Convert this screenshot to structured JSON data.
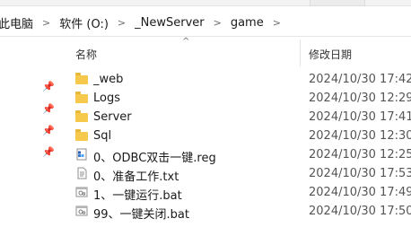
{
  "breadcrumb": {
    "items": [
      {
        "label": "此电脑"
      },
      {
        "label": "软件 (O:)"
      },
      {
        "label": "_NewServer"
      },
      {
        "label": "game"
      }
    ]
  },
  "header": {
    "name_label": "名称",
    "date_label": "修改日期"
  },
  "files": [
    {
      "name": "_web",
      "date": "2024/10/30 17:42",
      "icon": "folder-icon"
    },
    {
      "name": "Logs",
      "date": "2024/10/30 12:29",
      "icon": "folder-icon"
    },
    {
      "name": "Server",
      "date": "2024/10/30 17:41",
      "icon": "folder-icon"
    },
    {
      "name": "Sql",
      "date": "2024/10/30 12:30",
      "icon": "folder-icon"
    },
    {
      "name": "0、ODBC双击一键.reg",
      "date": "2024/10/30 12:25",
      "icon": "registry-file-icon"
    },
    {
      "name": "0、准备工作.txt",
      "date": "2024/10/30 17:53",
      "icon": "text-file-icon"
    },
    {
      "name": "1、一键运行.bat",
      "date": "2024/10/30 17:49",
      "icon": "batch-file-icon"
    },
    {
      "name": "99、一键关闭.bat",
      "date": "2024/10/30 17:50",
      "icon": "batch-file-icon"
    }
  ],
  "colors": {
    "folder": "#f6c94d",
    "folder_tab": "#e8b73b",
    "reg_blue": "#3a7bd5"
  }
}
